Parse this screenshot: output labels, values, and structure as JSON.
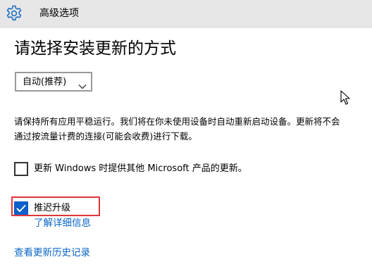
{
  "titlebar": {
    "icon": "gear-icon",
    "title": "高级选项"
  },
  "heading": "请选择安装更新的方式",
  "update_mode_select": {
    "selected": "自动(推荐)",
    "icon": "chevron-down-icon"
  },
  "description": "请保持所有应用平稳运行。我们将在你未使用设备时自动重新启动设备。更新将不会通过按流量计费的连接(可能会收费)进行下载。",
  "options": [
    {
      "label": "更新 Windows 时提供其他 Microsoft 产品的更新。",
      "checked": false
    },
    {
      "label": "推迟升级",
      "checked": true
    }
  ],
  "links": {
    "learn_more": "了解详细信息",
    "history": "查看更新历史记录"
  },
  "colors": {
    "titlebar_bg": "#e6e6e6",
    "accent": "#0a5fc9",
    "link": "#0a66c8",
    "highlight": "#e0363a"
  }
}
